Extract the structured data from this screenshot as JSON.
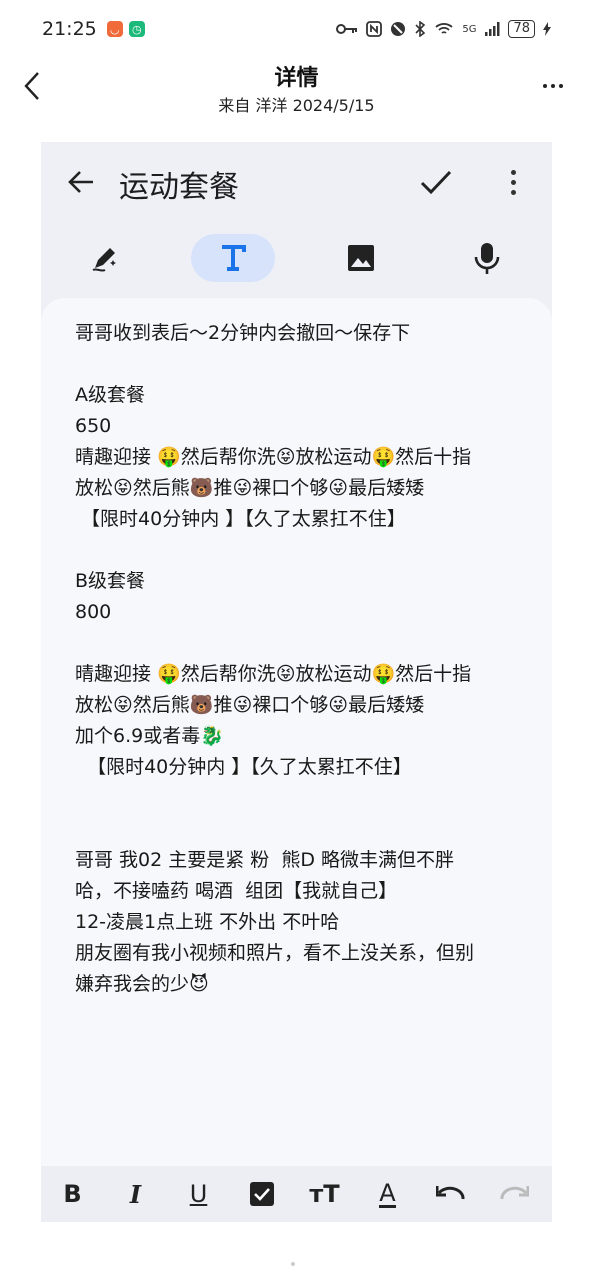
{
  "status_bar": {
    "time": "21:25",
    "battery": "78",
    "network": "5G",
    "icons": [
      "key-icon",
      "nfc-icon",
      "mute-icon",
      "bluetooth-icon",
      "wifi-icon",
      "signal-icon",
      "charging-icon"
    ]
  },
  "header": {
    "title": "详情",
    "subtitle": "来自 洋洋 2024/5/15"
  },
  "note": {
    "title": "运动套餐",
    "lines": [
      "哥哥收到表后～2分钟内会撤回～保存下",
      "",
      "A级套餐",
      "650",
      "晴趣迎接 🤑然后帮你洗😝放松运动🤑然后十指",
      "放松😝然后熊🐻推😜裸口个够😜最后矮矮",
      " 【限时40分钟内 】【久了太累扛不住】",
      "",
      "B级套餐",
      "800",
      "",
      "晴趣迎接 🤑然后帮你洗😝放松运动🤑然后十指",
      "放松😝然后熊🐻推😜裸口个够😜最后矮矮",
      "加个6.9或者毒🐉",
      "  【限时40分钟内 】【久了太累扛不住】",
      "",
      "",
      "哥哥 我02 主要是紧 粉  熊D 略微丰满但不胖",
      "哈，不接嗑药 喝酒  组团【我就自己】",
      "12-凌晨1点上班 不外出 不叶哈",
      "朋友圈有我小视频和照片，看不上没关系，但别",
      "嫌弃我会的少😈"
    ]
  },
  "format_bar": {
    "bold": "B",
    "italic": "I",
    "underline": "U",
    "text_size": "тT",
    "text_color": "A"
  },
  "colors": {
    "accent": "#1a73e8",
    "active_mode_bg": "#d7e3fb",
    "panel_bg": "#eef0f6"
  }
}
